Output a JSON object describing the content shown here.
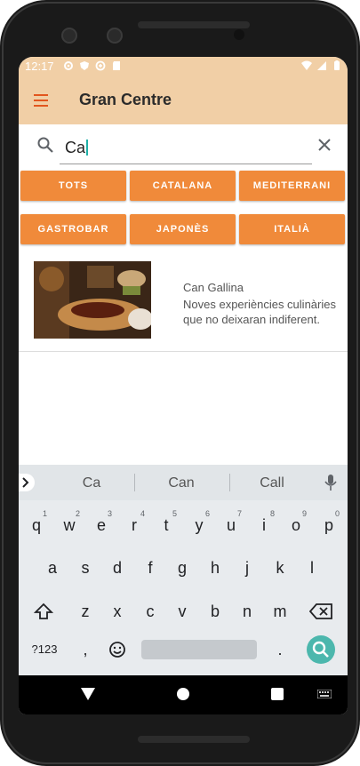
{
  "status_bar": {
    "time": "12:17"
  },
  "app_bar": {
    "title": "Gran Centre"
  },
  "search": {
    "value": "Ca"
  },
  "categories": [
    "TOTS",
    "CATALANA",
    "MEDITERRANI",
    "GASTROBAR",
    "JAPONÈS",
    "ITALIÀ"
  ],
  "results": [
    {
      "name": "Can Gallina",
      "description": "Noves experiències culinàries que no deixaran indiferent."
    }
  ],
  "keyboard": {
    "suggestions": [
      "Ca",
      "Can",
      "Call"
    ],
    "row1": [
      "q",
      "w",
      "e",
      "r",
      "t",
      "y",
      "u",
      "i",
      "o",
      "p"
    ],
    "row1_hints": [
      "1",
      "2",
      "3",
      "4",
      "5",
      "6",
      "7",
      "8",
      "9",
      "0"
    ],
    "row2": [
      "a",
      "s",
      "d",
      "f",
      "g",
      "h",
      "j",
      "k",
      "l"
    ],
    "row3": [
      "z",
      "x",
      "c",
      "v",
      "b",
      "n",
      "m"
    ],
    "symbols_label": "?123",
    "comma": ",",
    "period": "."
  },
  "colors": {
    "app_bar": "#f1cfa6",
    "chip": "#f08a3a",
    "menu_icon": "#e2561e",
    "cursor": "#1fb0a8",
    "search_key": "#4cb7ad"
  }
}
